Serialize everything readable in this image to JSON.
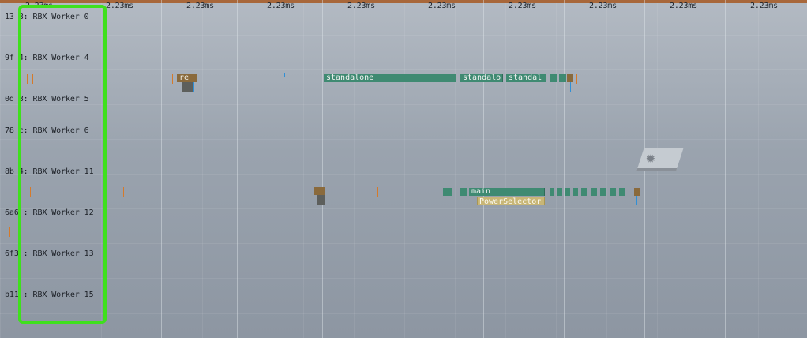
{
  "timeline": {
    "ticks": [
      "2.23ms",
      "2.23ms",
      "2.23ms",
      "2.23ms",
      "2.23ms",
      "2.23ms",
      "2.23ms",
      "2.23ms",
      "2.23ms",
      "2.23ms"
    ]
  },
  "rows": [
    {
      "label": "13 8: RBX Worker 0"
    },
    {
      "label": "9f 4: RBX Worker 4"
    },
    {
      "label": "0d 8: RBX Worker 5"
    },
    {
      "label": "78 c: RBX Worker 6"
    },
    {
      "label": "8b 4: RBX Worker 11"
    },
    {
      "label": "6a6 : RBX Worker 12"
    },
    {
      "label": "6f3 : RBX Worker 13"
    },
    {
      "label": "b11 : RBX Worker 15"
    }
  ],
  "events": {
    "re": "re",
    "standalone": "standalone",
    "standalo": "standalo",
    "standal": "standal",
    "main": "main",
    "power_selector": "PowerSelector"
  },
  "colors": {
    "top_bar": "#a8673a",
    "event_bar": "#3f8a72",
    "highlight": "#3fe01d",
    "marker": "#d57a2a",
    "power_selector": "#c8b676"
  }
}
